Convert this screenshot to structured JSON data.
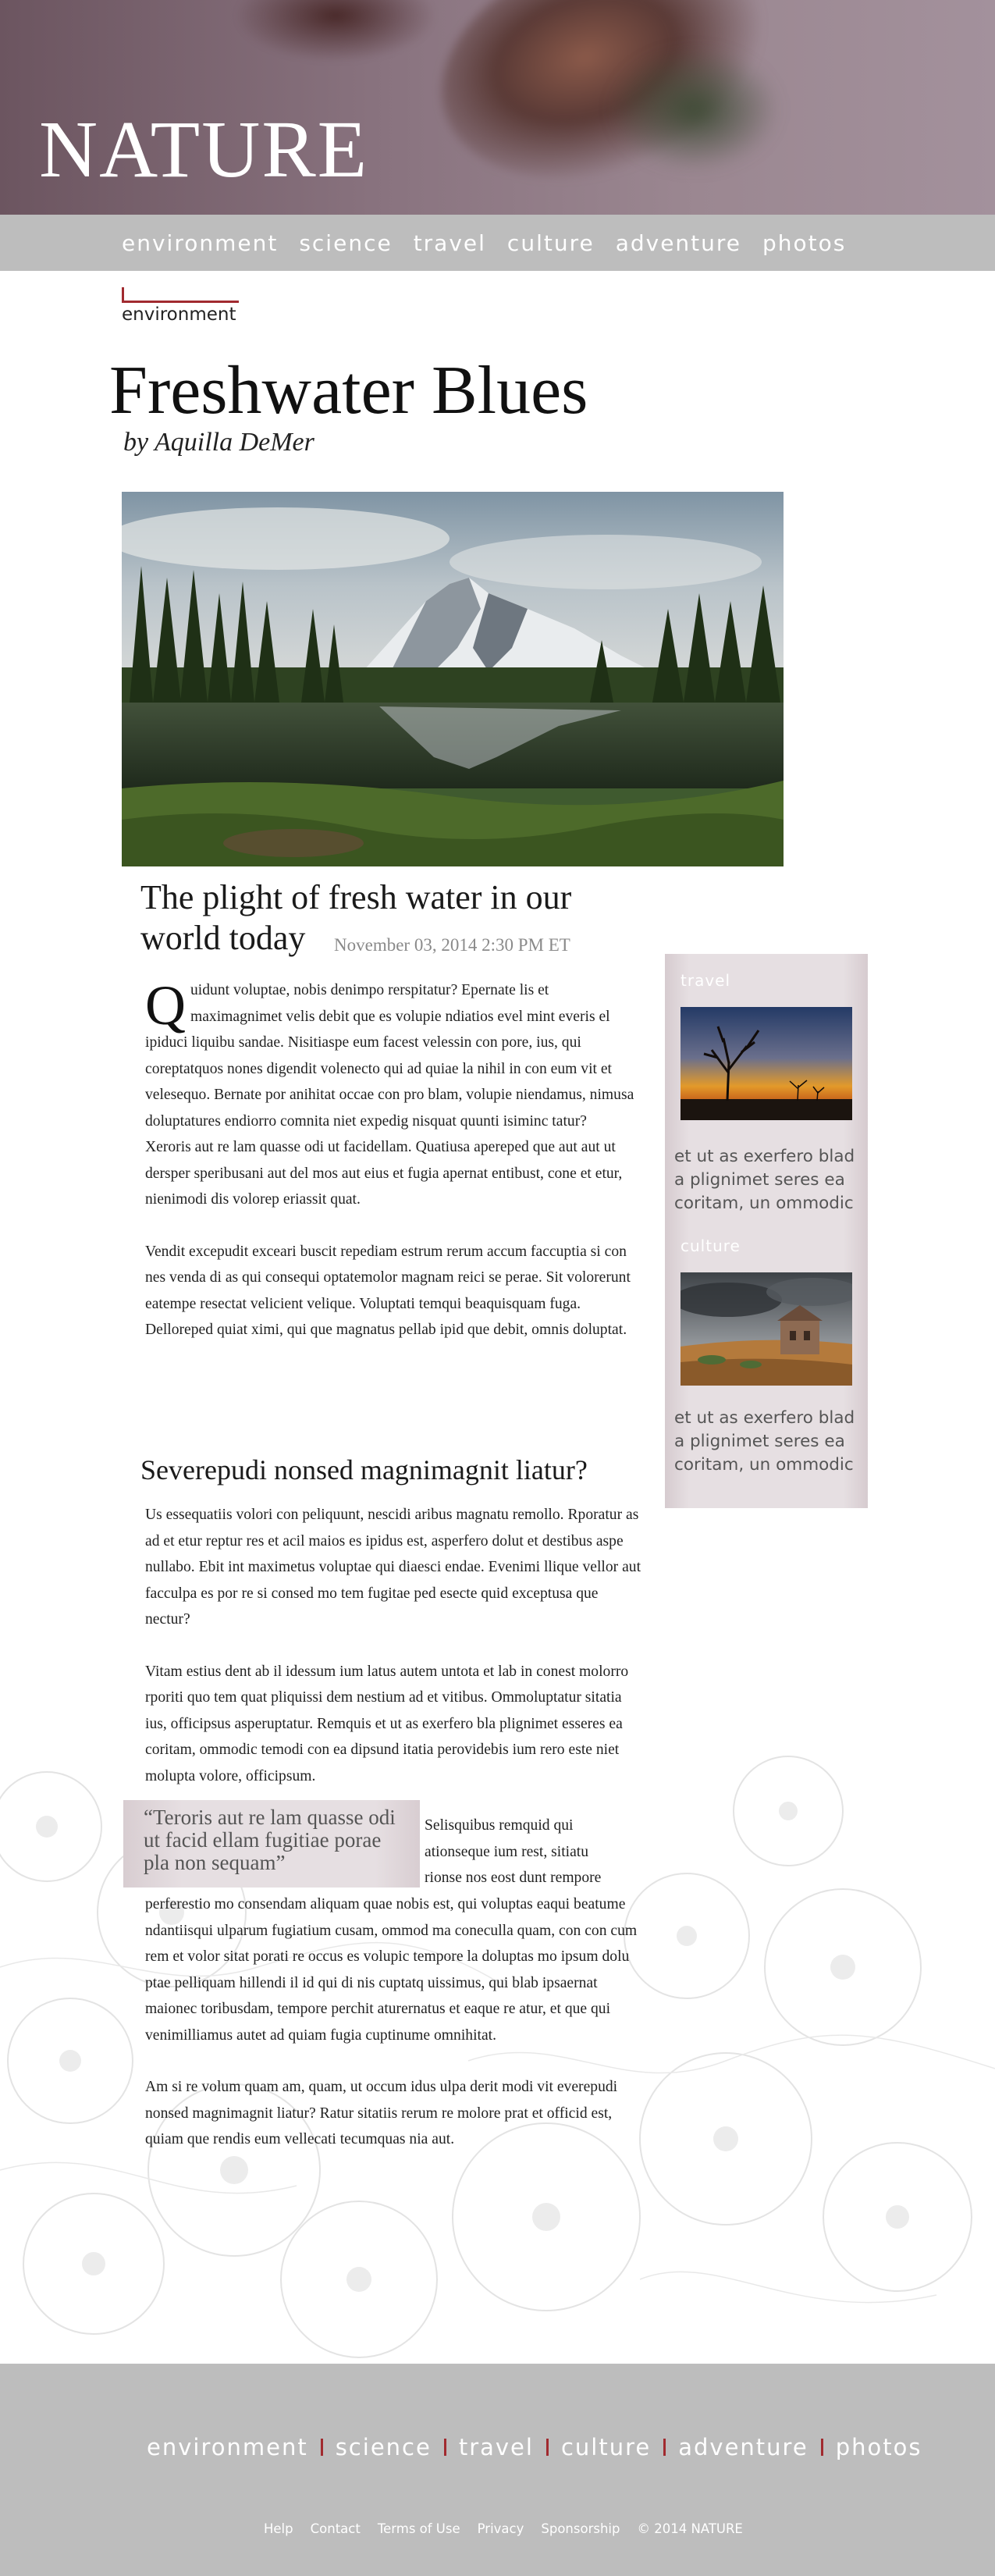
{
  "site": {
    "name": "NATURE"
  },
  "nav": [
    "environment",
    "science",
    "travel",
    "culture",
    "adventure",
    "photos"
  ],
  "article": {
    "section": "environment",
    "title": "Freshwater Blues",
    "byline": "by Aquilla DeMer",
    "subtitle_line1": "The plight of fresh water in our",
    "subtitle_line2": "world today",
    "date": "November 03, 2014 2:30 PM ET",
    "dropcap": "Q",
    "paragraphs": [
      "uidunt voluptae, nobis denimpo rerspitatur?  Epernate lis et maximagnimet velis debit que es volupie ndiatios evel mint everis el ipiduci liquibu sandae. Nisitiaspe eum facest velessin con pore, ius, qui coreptatquos nones digendit volenecto qui ad quiae la nihil in con eum vit et velesequo. Bernate por anihitat occae con pro blam, volupie niendamus, nimusa doluptatures endiorro comnita niet expedig nisquat quunti isiminc tatur?",
      "Xeroris aut re lam quasse odi ut facidellam. Quatiusa apereped que aut aut ut dersper speribusani aut del mos aut eius et fugia apernat entibust, cone et etur, nienimodi dis volorep eriassit quat.",
      "Vendit excepudit exceari buscit repediam estrum rerum accum faccuptia si con nes venda di as qui consequi optatemolor magnam reici se perae. Sit volorerunt eatempe resectat velicient velique. Voluptati temqui beaquisquam fuga. Delloreped quiat ximi, qui que magnatus pellab ipid que debit, omnis doluptat."
    ],
    "heading2": "Severepudi nonsed magnimagnit liatur?",
    "paragraphs2": [
      "Us essequatiis volori con peliquunt, nescidi aribus magnatu remollo. Rporatur as ad et etur reptur res et acil maios es ipidus est, asperfero dolut et destibus aspe nullabo. Ebit int maximetus voluptae qui diaesci endae. Evenimi llique vellor aut facculpa es por re si consed mo tem fugitae ped esecte quid exceptusa que nectur?",
      "Vitam estius dent ab il idessum ium latus autem untota et lab in conest molorro rporiti quo tem quat pliquissi dem nestium ad et vitibus. Ommoluptatur sitatia ius, officipsus asperuptatur. Remquis et ut as exerfero bla plignimet esseres ea coritam, ommodic temodi con ea dipsund itatia perovidebis ium rero este niet molupta volore, officipsum."
    ],
    "pullquote": "“Teroris aut re lam quasse odi ut facid ellam fugitiae porae pla non sequam”",
    "wrap_lines": [
      "Selisquibus remquid qui",
      "ationseque ium  rest, sitiatu",
      "rionse nos eost dunt rempore"
    ],
    "wrap_rest": "perferestio mo consendam aliquam quae nobis est, qui voluptas eaqui beatume ndantiisqui ulparum fugiatium cusam, ommod ma coneculla quam, con con cum rem et volor sitat porati re occus es volupic tempore la doluptas mo ipsum dolu ptae pelliquam hillendi il id qui di nis cuptatq uissimus, qui blab ipsaernat maionec toribusdam, tempore perchit aturernatus et eaque re atur, et que qui venimilliamus autet ad quiam fugia cuptinume omnihitat.",
    "final_paragraph": "Am si re volum quam am, quam, ut occum idus ulpa derit modi vit everepudi nonsed magnimagnit liatur? Ratur sitatiis rerum re molore prat et officid est, quiam que rendis eum vellecati tecumquas nia aut."
  },
  "sidebar": {
    "items": [
      {
        "category": "travel",
        "caption": "et ut as exerfero blad a plignimet seres ea coritam, un ommodic",
        "image": "tree-sunset-photo"
      },
      {
        "category": "culture",
        "caption": "et ut as exerfero blad a plignimet seres ea coritam, un ommodic",
        "image": "stone-ruin-photo"
      }
    ]
  },
  "footer": {
    "nav": [
      "environment",
      "science",
      "travel",
      "culture",
      "adventure",
      "photos"
    ],
    "links": [
      "Help",
      "Contact",
      "Terms of Use",
      "Privacy",
      "Sponsorship"
    ],
    "copyright": "© 2014 NATURE"
  },
  "colors": {
    "accent": "#a12a2f",
    "nav_bg": "#bdbdbd",
    "sidebar_bg": "#e6dfe2",
    "banner": "#8a7480"
  }
}
